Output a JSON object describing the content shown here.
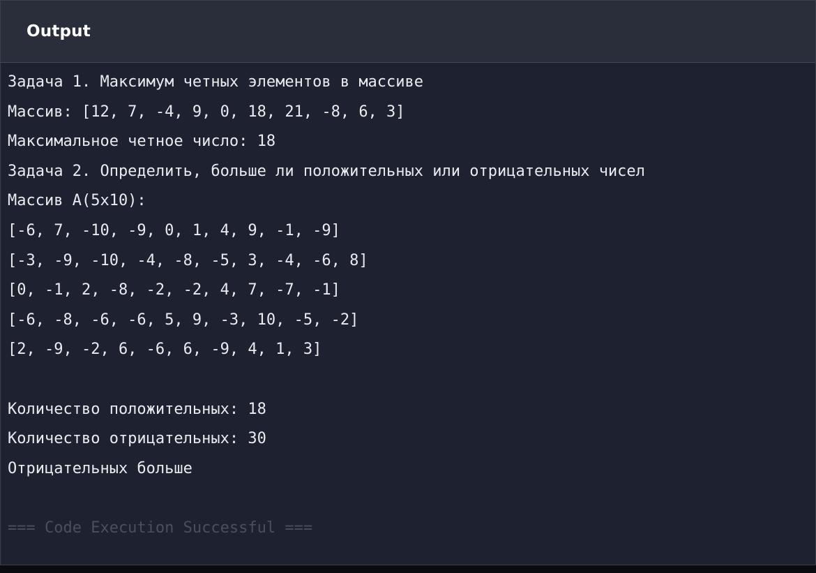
{
  "header": {
    "title": "Output"
  },
  "output": {
    "lines": [
      "Задача 1. Максимум четных элементов в массиве",
      "Массив: [12, 7, -4, 9, 0, 18, 21, -8, 6, 3]",
      "Максимальное четное число: 18",
      "Задача 2. Определить, больше ли положительных или отрицательных чисел",
      "Массив A(5x10):",
      "[-6, 7, -10, -9, 0, 1, 4, 9, -1, -9]",
      "[-3, -9, -10, -4, -8, -5, 3, -4, -6, 8]",
      "[0, -1, 2, -8, -2, -2, 4, 7, -7, -1]",
      "[-6, -8, -6, -6, 5, 9, -3, 10, -5, -2]",
      "[2, -9, -2, 6, -6, 6, -9, 4, 1, 3]",
      "",
      "Количество положительных: 18",
      "Количество отрицательных: 30",
      "Отрицательных больше",
      "",
      "=== Code Execution Successful ==="
    ]
  },
  "colors": {
    "panel_background": "#1e2130",
    "header_background": "#2a2d3a",
    "text": "#e9ebf0",
    "muted_text": "#4a4f5e"
  }
}
